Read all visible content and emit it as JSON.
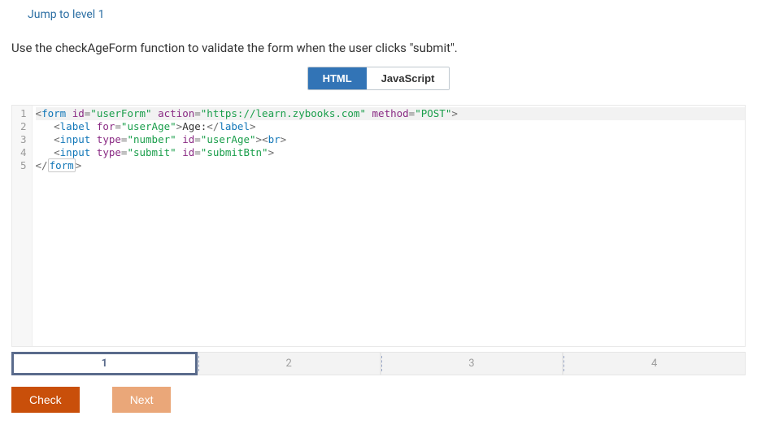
{
  "jump_link": "Jump to level 1",
  "prompt": "Use the checkAgeForm function to validate the form when the user clicks \"submit\".",
  "tabs": {
    "html": "HTML",
    "js": "JavaScript",
    "active": "html"
  },
  "code": {
    "lines": [
      {
        "n": 1,
        "tokens": [
          {
            "t": "<",
            "c": "op"
          },
          {
            "t": "form",
            "c": "tag"
          },
          {
            "t": " ",
            "c": "txt"
          },
          {
            "t": "id",
            "c": "attr"
          },
          {
            "t": "=",
            "c": "op"
          },
          {
            "t": "\"userForm\"",
            "c": "str"
          },
          {
            "t": " ",
            "c": "txt"
          },
          {
            "t": "action",
            "c": "attr"
          },
          {
            "t": "=",
            "c": "op"
          },
          {
            "t": "\"https://learn.zybooks.com\"",
            "c": "str"
          },
          {
            "t": " ",
            "c": "txt"
          },
          {
            "t": "method",
            "c": "attr"
          },
          {
            "t": "=",
            "c": "op"
          },
          {
            "t": "\"POST\"",
            "c": "str"
          },
          {
            "t": ">",
            "c": "op"
          }
        ]
      },
      {
        "n": 2,
        "tokens": [
          {
            "t": "   ",
            "c": "txt"
          },
          {
            "t": "<",
            "c": "op"
          },
          {
            "t": "label",
            "c": "tag"
          },
          {
            "t": " ",
            "c": "txt"
          },
          {
            "t": "for",
            "c": "attr"
          },
          {
            "t": "=",
            "c": "op"
          },
          {
            "t": "\"userAge\"",
            "c": "str"
          },
          {
            "t": ">",
            "c": "op"
          },
          {
            "t": "Age:",
            "c": "txt"
          },
          {
            "t": "</",
            "c": "op"
          },
          {
            "t": "label",
            "c": "tag"
          },
          {
            "t": ">",
            "c": "op"
          }
        ]
      },
      {
        "n": 3,
        "tokens": [
          {
            "t": "   ",
            "c": "txt"
          },
          {
            "t": "<",
            "c": "op"
          },
          {
            "t": "input",
            "c": "tag"
          },
          {
            "t": " ",
            "c": "txt"
          },
          {
            "t": "type",
            "c": "attr"
          },
          {
            "t": "=",
            "c": "op"
          },
          {
            "t": "\"number\"",
            "c": "str"
          },
          {
            "t": " ",
            "c": "txt"
          },
          {
            "t": "id",
            "c": "attr"
          },
          {
            "t": "=",
            "c": "op"
          },
          {
            "t": "\"userAge\"",
            "c": "str"
          },
          {
            "t": ">",
            "c": "op"
          },
          {
            "t": "<",
            "c": "op"
          },
          {
            "t": "br",
            "c": "tag"
          },
          {
            "t": ">",
            "c": "op"
          }
        ]
      },
      {
        "n": 4,
        "tokens": [
          {
            "t": "   ",
            "c": "txt"
          },
          {
            "t": "<",
            "c": "op"
          },
          {
            "t": "input",
            "c": "tag"
          },
          {
            "t": " ",
            "c": "txt"
          },
          {
            "t": "type",
            "c": "attr"
          },
          {
            "t": "=",
            "c": "op"
          },
          {
            "t": "\"submit\"",
            "c": "str"
          },
          {
            "t": " ",
            "c": "txt"
          },
          {
            "t": "id",
            "c": "attr"
          },
          {
            "t": "=",
            "c": "op"
          },
          {
            "t": "\"submitBtn\"",
            "c": "str"
          },
          {
            "t": ">",
            "c": "op"
          }
        ]
      },
      {
        "n": 5,
        "tokens": [
          {
            "t": "</",
            "c": "op"
          },
          {
            "t": "form",
            "c": "tag",
            "box": true
          },
          {
            "t": ">",
            "c": "op"
          }
        ]
      }
    ]
  },
  "steps": [
    "1",
    "2",
    "3",
    "4"
  ],
  "active_step": 0,
  "buttons": {
    "check": "Check",
    "next": "Next"
  }
}
